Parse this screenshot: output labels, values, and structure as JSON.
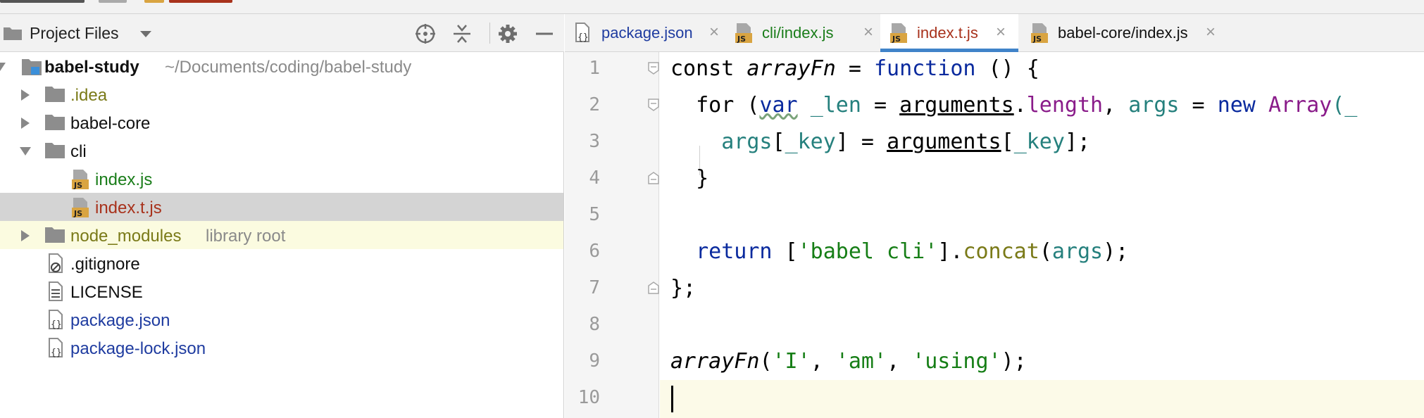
{
  "panel": {
    "title": "Project Files"
  },
  "tree": [
    {
      "label": "babel-study",
      "sub": "~/Documents/coding/babel-study",
      "color": "#111111"
    },
    {
      "label": ".idea",
      "sub": "",
      "color": "#7a7a18"
    },
    {
      "label": "babel-core",
      "sub": "",
      "color": "#111111"
    },
    {
      "label": "cli",
      "sub": "",
      "color": "#111111"
    },
    {
      "label": "index.js",
      "sub": "",
      "color": "#1a7d1a"
    },
    {
      "label": "index.t.js",
      "sub": "",
      "color": "#a8321c"
    },
    {
      "label": "node_modules",
      "sub": "library root",
      "color": "#7a7a18"
    },
    {
      "label": ".gitignore",
      "sub": "",
      "color": "#111111"
    },
    {
      "label": "LICENSE",
      "sub": "",
      "color": "#111111"
    },
    {
      "label": "package.json",
      "sub": "",
      "color": "#1f3ca0"
    },
    {
      "label": "package-lock.json",
      "sub": "",
      "color": "#1f3ca0"
    }
  ],
  "tabs": [
    {
      "label": "package.json",
      "color": "#1f3ca0"
    },
    {
      "label": "cli/index.js",
      "color": "#1a7d1a"
    },
    {
      "label": "index.t.js",
      "color": "#a8321c"
    },
    {
      "label": "babel-core/index.js",
      "color": "#111111"
    }
  ],
  "close_glyph": "×",
  "line_numbers": [
    "1",
    "2",
    "3",
    "4",
    "5",
    "6",
    "7",
    "8",
    "9",
    "10"
  ],
  "code": {
    "l1": {
      "a": "const ",
      "b": "arrayFn",
      "c": " = ",
      "d": "function",
      "e": " () {"
    },
    "l2": {
      "a": "  for (",
      "b": "var",
      "c": " ",
      "d": "_len",
      "e": " = ",
      "f": "arguments",
      "g": ".",
      "h": "length",
      "i": ", ",
      "j": "args",
      "k": " = ",
      "l": "new",
      "m": " ",
      "n": "Array",
      "o": "(_"
    },
    "l3": {
      "a": "    ",
      "b": "args",
      "c": "[",
      "d": "_key",
      "e": "] = ",
      "f": "arguments",
      "g": "[",
      "h": "_key",
      "i": "];"
    },
    "l4": {
      "a": "  }"
    },
    "l6": {
      "a": "  ",
      "b": "return",
      "c": " [",
      "d": "'babel cli'",
      "e": "].",
      "f": "concat",
      "g": "(",
      "h": "args",
      "i": ");"
    },
    "l7": {
      "a": "};"
    },
    "l9": {
      "a": "arrayFn",
      "b": "(",
      "c": "'I'",
      "d": ", ",
      "e": "'am'",
      "f": ", ",
      "g": "'using'",
      "h": ");"
    }
  },
  "colors": {
    "accent": "#4083c9",
    "selected_row": "#d4d4d4",
    "library_row": "#fbfbe0",
    "current_line": "#fcfae8"
  }
}
